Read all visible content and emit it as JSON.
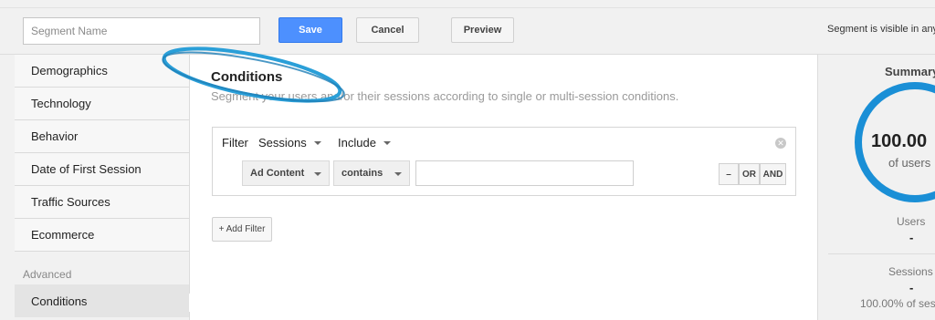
{
  "header": {
    "segment_name_placeholder": "Segment Name",
    "save_label": "Save",
    "cancel_label": "Cancel",
    "preview_label": "Preview",
    "visibility_text": "Segment is visible in any"
  },
  "sidebar": {
    "items": [
      {
        "label": "Demographics"
      },
      {
        "label": "Technology"
      },
      {
        "label": "Behavior"
      },
      {
        "label": "Date of First Session"
      },
      {
        "label": "Traffic Sources"
      },
      {
        "label": "Ecommerce"
      }
    ],
    "group_label": "Advanced",
    "active_item": {
      "label": "Conditions"
    }
  },
  "main": {
    "title": "Conditions",
    "subtitle": "Segment your users and/or their sessions according to single or multi-session conditions.",
    "filter": {
      "label": "Filter",
      "scope": "Sessions",
      "mode": "Include",
      "dimension": "Ad Content",
      "operator": "contains",
      "value": "",
      "remove_label": "–",
      "or_label": "OR",
      "and_label": "AND"
    },
    "add_filter_label": "+ Add Filter"
  },
  "summary": {
    "title": "Summary",
    "percent": "100.00",
    "of_users": "of users",
    "users_label": "Users",
    "users_value": "-",
    "sessions_label": "Sessions",
    "sessions_value": "-",
    "sessions_pct": "100.00% of ses"
  },
  "colors": {
    "primary_button": "#4d90fe",
    "ring": "#1a8fd6",
    "highlight": "#2a9fd8"
  }
}
